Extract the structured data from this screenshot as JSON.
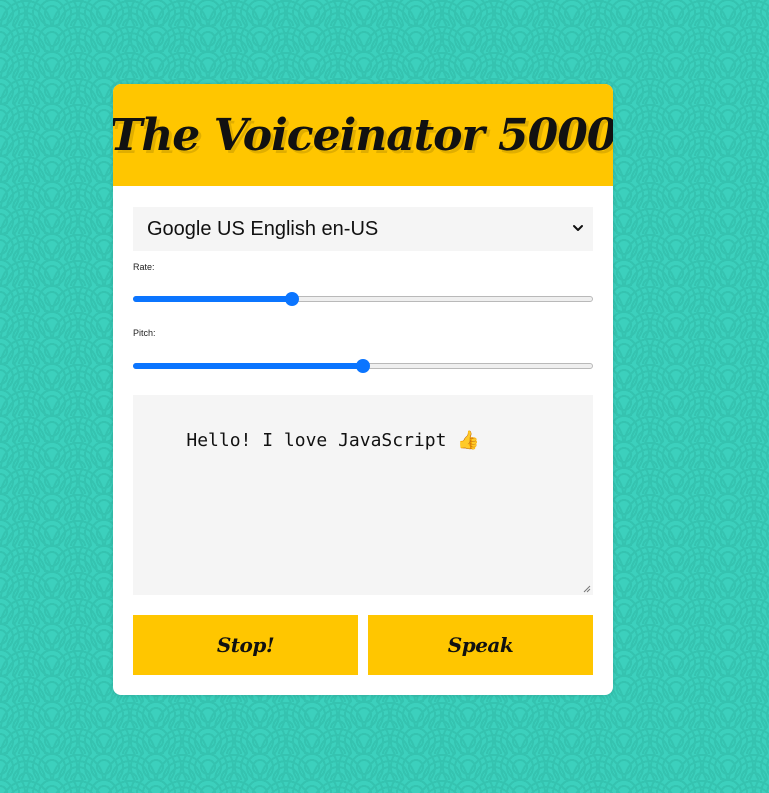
{
  "app": {
    "title": "The Voiceinator 5000"
  },
  "voice_select": {
    "selected": "Google US English en-US"
  },
  "rate": {
    "label": "Rate:",
    "value_fraction": 0.34
  },
  "pitch": {
    "label": "Pitch:",
    "value_fraction": 0.5
  },
  "message": {
    "text": "Hello! I love JavaScript 👍"
  },
  "buttons": {
    "stop": "Stop!",
    "speak": "Speak"
  },
  "colors": {
    "accent": "#ffc600",
    "background": "#3cd0bd",
    "slider": "#0b75ff"
  },
  "icons": {
    "dropdown": "chevron-down-icon",
    "resize": "resize-grip-icon"
  }
}
